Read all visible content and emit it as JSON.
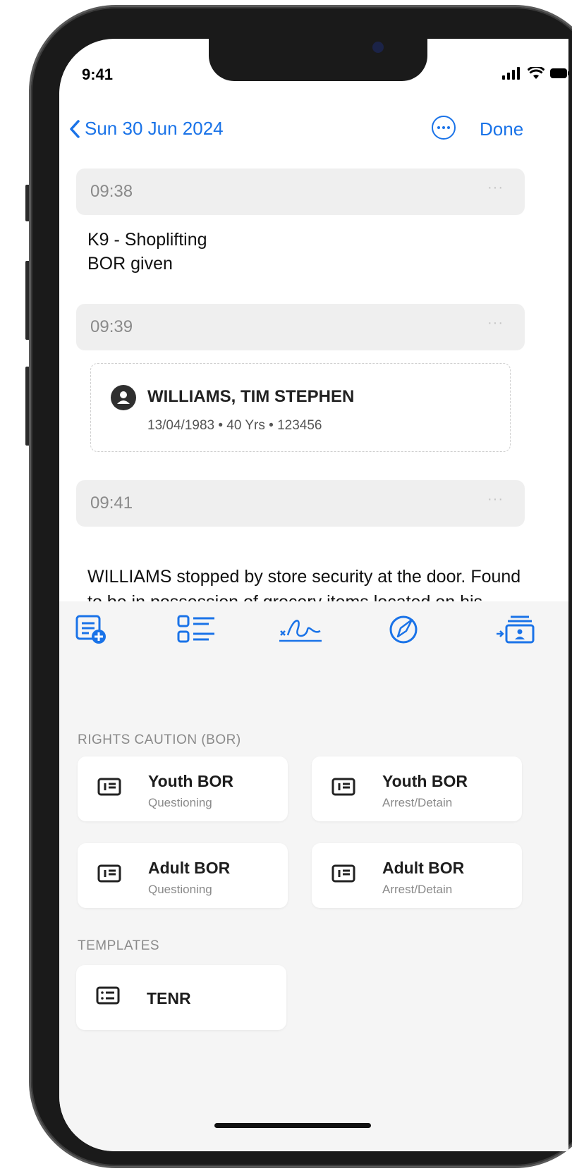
{
  "status_bar": {
    "time": "9:41"
  },
  "nav": {
    "back_label": "Sun 30 Jun 2024",
    "done_label": "Done"
  },
  "entries": [
    {
      "time": "09:38",
      "lines": [
        "K9 - Shoplifting",
        "BOR given"
      ]
    },
    {
      "time": "09:39",
      "person": {
        "name": "WILLIAMS, TIM STEPHEN",
        "details": "13/04/1983 • 40 Yrs • 123456"
      }
    },
    {
      "time": "09:41",
      "text": "WILLIAMS stopped by store security at the door. Found to be in possession of grocery items located on his person"
    }
  ],
  "toolbar": {
    "icons": [
      "add-note-icon",
      "checklist-icon",
      "signature-icon",
      "compass-icon",
      "person-card-icon"
    ]
  },
  "rights_caution": {
    "label": "RIGHTS CAUTION (BOR)",
    "items": [
      {
        "title": "Youth BOR",
        "subtitle": "Questioning"
      },
      {
        "title": "Youth BOR",
        "subtitle": "Arrest/Detain"
      },
      {
        "title": "Adult BOR",
        "subtitle": "Questioning"
      },
      {
        "title": "Adult BOR",
        "subtitle": "Arrest/Detain"
      }
    ]
  },
  "templates": {
    "label": "TEMPLATES",
    "items": [
      {
        "title": "TENR"
      }
    ]
  },
  "colors": {
    "accent": "#1a73e8",
    "panel_bg": "#f5f5f5",
    "time_bar_bg": "#efefef"
  }
}
